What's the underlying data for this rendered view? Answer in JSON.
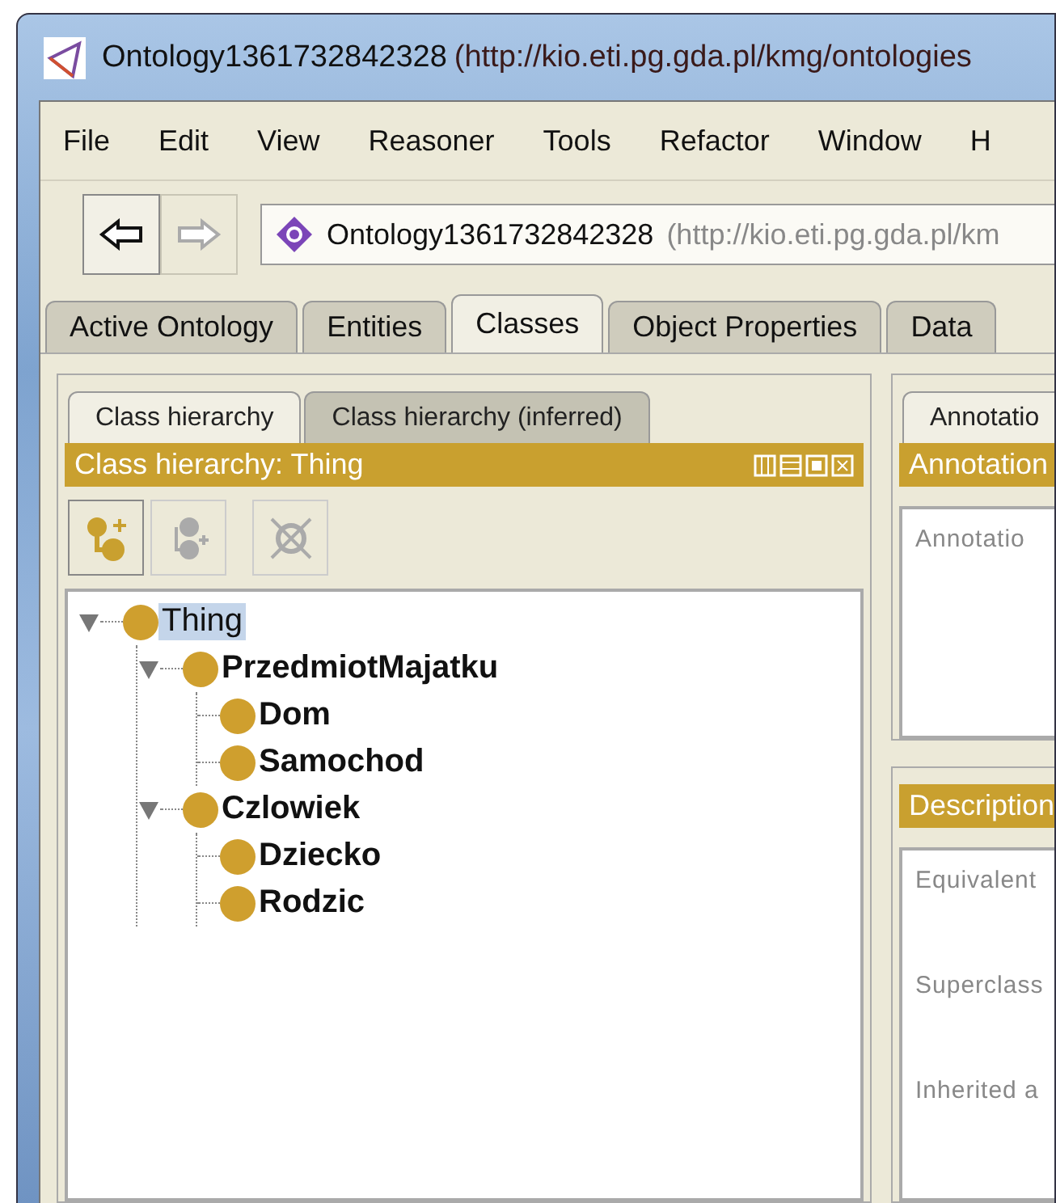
{
  "window": {
    "title": "Ontology1361732842328",
    "title_uri": "(http://kio.eti.pg.gda.pl/kmg/ontologies"
  },
  "menu": [
    "File",
    "Edit",
    "View",
    "Reasoner",
    "Tools",
    "Refactor",
    "Window",
    "H"
  ],
  "nav": {
    "back_disabled": false,
    "forward_disabled": true,
    "address": "Ontology1361732842328",
    "address_uri": "(http://kio.eti.pg.gda.pl/km"
  },
  "tabs": [
    {
      "label": "Active Ontology",
      "selected": false
    },
    {
      "label": "Entities",
      "selected": false
    },
    {
      "label": "Classes",
      "selected": true
    },
    {
      "label": "Object Properties",
      "selected": false
    },
    {
      "label": "Data",
      "selected": false
    }
  ],
  "left_panel": {
    "tabs": [
      {
        "label": "Class hierarchy",
        "selected": true
      },
      {
        "label": "Class hierarchy (inferred)",
        "selected": false
      }
    ],
    "header": "Class hierarchy: Thing",
    "tools": [
      {
        "kind": "add-subclass",
        "disabled": false
      },
      {
        "kind": "add-sibling",
        "disabled": true
      },
      {
        "kind": "delete",
        "disabled": true
      }
    ],
    "tree": [
      {
        "label": "Thing",
        "bold": false,
        "selected": true,
        "expanded": true,
        "children": [
          {
            "label": "PrzedmiotMajatku",
            "bold": true,
            "selected": false,
            "expanded": true,
            "children": [
              {
                "label": "Dom",
                "bold": true,
                "selected": false
              },
              {
                "label": "Samochod",
                "bold": true,
                "selected": false
              }
            ]
          },
          {
            "label": "Czlowiek",
            "bold": true,
            "selected": false,
            "expanded": true,
            "children": [
              {
                "label": "Dziecko",
                "bold": true,
                "selected": false
              },
              {
                "label": "Rodzic",
                "bold": true,
                "selected": false
              }
            ]
          }
        ]
      }
    ]
  },
  "right_panel": {
    "tab": "Annotatio",
    "annotations_header": "Annotation",
    "annotations_label": "Annotatio",
    "description_header": "Description",
    "description_labels": [
      "Equivalent",
      "Superclass",
      "Inherited a"
    ]
  }
}
